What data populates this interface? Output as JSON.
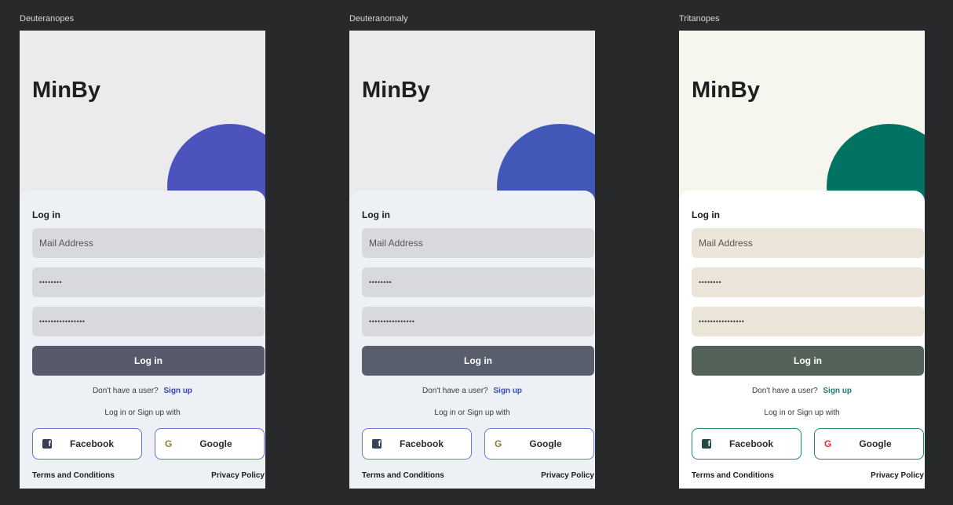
{
  "app": {
    "title": "MinBy",
    "login_heading": "Log in",
    "email_placeholder": "Mail Address",
    "password_mask": "••••••••",
    "confirm_mask": "••••••••••••••••",
    "login_button": "Log in",
    "no_user_text": "Don't have a user?",
    "signup_link": "Sign up",
    "social_caption": "Log in or Sign up with",
    "facebook_label": "Facebook",
    "google_label": "Google",
    "terms_link": "Terms and Conditions",
    "privacy_link": "Privacy Policy"
  },
  "variants": [
    {
      "label": "Deuteranopes",
      "colors": {
        "background": "#ebebed",
        "circle": "#4d53bc",
        "card": "#edf0f4",
        "field": "#d8d9dc",
        "button": "#575a6b",
        "link": "#3c44b4",
        "social_border": "#6b6fd0",
        "google_g": "#8b7e3a",
        "fb_icon": "#3b3f55"
      }
    },
    {
      "label": "Deuteranomaly",
      "colors": {
        "background": "#ebebed",
        "circle": "#4258b8",
        "card": "#edf0f4",
        "field": "#d8d9dc",
        "button": "#585e6c",
        "link": "#3a4cb5",
        "social_border": "#6d7ad4",
        "google_g": "#8a7c3e",
        "fb_icon": "#3b4157"
      }
    },
    {
      "label": "Tritanopes",
      "colors": {
        "background": "#f6f5ee",
        "circle": "#027363",
        "card": "#ffffff",
        "field": "#ebe6d9",
        "button": "#55625a",
        "link": "#1e7f6c",
        "social_border": "#1b8a73",
        "google_g": "#d4333a",
        "fb_icon": "#254a42"
      }
    }
  ]
}
